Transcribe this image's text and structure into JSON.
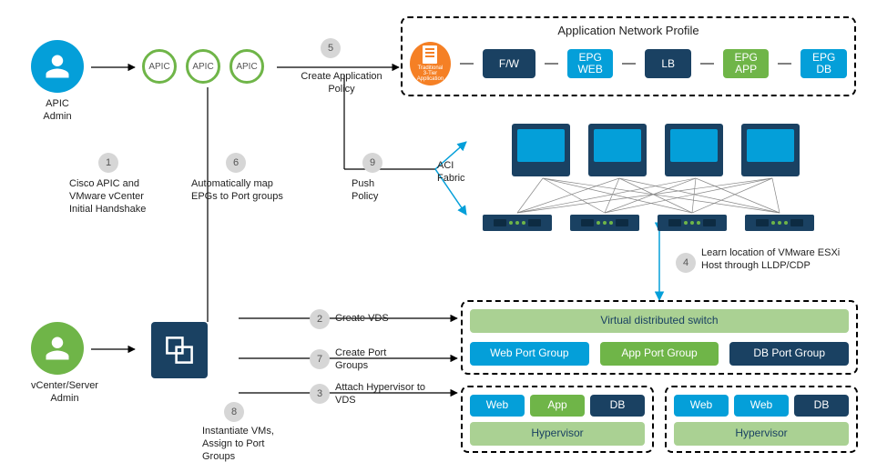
{
  "admins": {
    "apic": "APIC\nAdmin",
    "vcenter": "vCenter/Server\nAdmin"
  },
  "apic_label": "APIC",
  "anp": {
    "title": "Application Network Profile",
    "app_icon": "Traditional\n3-Tier\nApplication",
    "fw": "F/W",
    "epg_web": "EPG\nWEB",
    "lb": "LB",
    "epg_app": "EPG\nAPP",
    "epg_db": "EPG\nDB"
  },
  "steps": {
    "s1": {
      "num": "1",
      "text": "Cisco APIC and VMware vCenter Initial Handshake"
    },
    "s2": {
      "num": "2",
      "text": "Create VDS"
    },
    "s3": {
      "num": "3",
      "text": "Attach Hypervisor to VDS"
    },
    "s4": {
      "num": "4",
      "text": "Learn location of VMware ESXi Host through LLDP/CDP"
    },
    "s5": {
      "num": "5",
      "text": "Create Application Policy"
    },
    "s6": {
      "num": "6",
      "text": "Automatically map EPGs to Port groups"
    },
    "s7": {
      "num": "7",
      "text": "Create Port Groups"
    },
    "s8": {
      "num": "8",
      "text": "Instantiate VMs, Assign to Port Groups"
    },
    "s9": {
      "num": "9",
      "text": "Push Policy"
    }
  },
  "fabric_label": "ACI\nFabric",
  "vds": {
    "title": "Virtual distributed switch",
    "pg_web": "Web Port Group",
    "pg_app": "App Port Group",
    "pg_db": "DB Port Group"
  },
  "hv": {
    "label": "Hypervisor",
    "web": "Web",
    "app": "App",
    "db": "DB"
  }
}
